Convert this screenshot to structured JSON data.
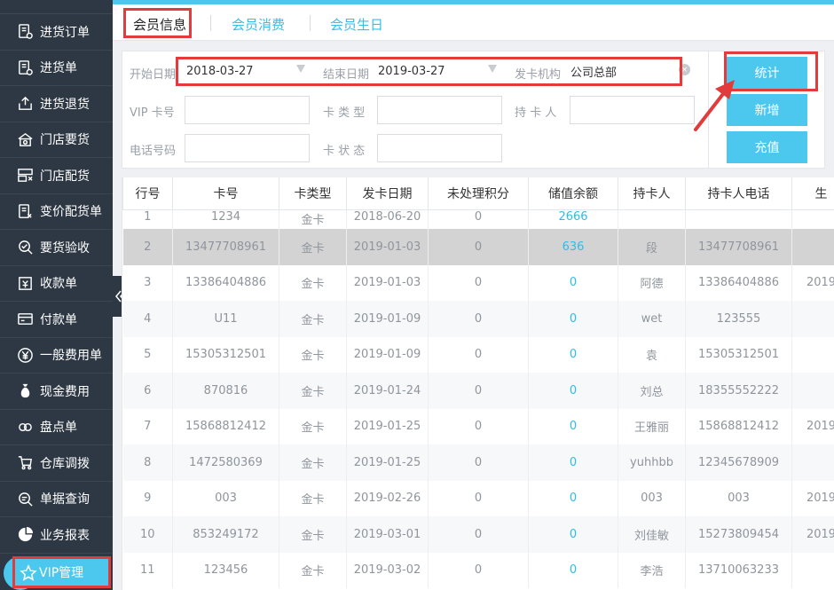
{
  "sidebar": {
    "items": [
      {
        "label": "进货订单",
        "icon": "purchase-order-icon"
      },
      {
        "label": "进货单",
        "icon": "purchase-receipt-icon"
      },
      {
        "label": "进货退货",
        "icon": "purchase-return-icon"
      },
      {
        "label": "门店要货",
        "icon": "store-request-icon"
      },
      {
        "label": "门店配货",
        "icon": "store-distribution-icon"
      },
      {
        "label": "变价配货单",
        "icon": "price-change-icon"
      },
      {
        "label": "要货验收",
        "icon": "acceptance-icon"
      },
      {
        "label": "收款单",
        "icon": "receipt-icon"
      },
      {
        "label": "付款单",
        "icon": "payment-icon"
      },
      {
        "label": "一般费用单",
        "icon": "yen-icon"
      },
      {
        "label": "现金费用",
        "icon": "cash-bag-icon"
      },
      {
        "label": "盘点单",
        "icon": "inventory-icon"
      },
      {
        "label": "仓库调拨",
        "icon": "cart-icon"
      },
      {
        "label": "单据查询",
        "icon": "search-document-icon"
      },
      {
        "label": "业务报表",
        "icon": "pie-chart-icon"
      }
    ],
    "vip": {
      "label": "VIP管理",
      "icon": "star-icon"
    }
  },
  "tabs": [
    {
      "label": "会员信息",
      "active": true
    },
    {
      "label": "会员消费",
      "active": false
    },
    {
      "label": "会员生日",
      "active": false
    }
  ],
  "filters": {
    "start_date": {
      "label": "开始日期",
      "value": "2018-03-27"
    },
    "end_date": {
      "label": "结束日期",
      "value": "2019-03-27"
    },
    "issuer": {
      "label": "发卡机构",
      "value": "公司总部"
    },
    "vip_card": {
      "label": "VIP 卡号",
      "value": ""
    },
    "card_type": {
      "label": "卡 类 型",
      "value": ""
    },
    "holder": {
      "label": "持 卡 人",
      "value": ""
    },
    "phone": {
      "label": "电话号码",
      "value": ""
    },
    "card_status": {
      "label": "卡 状 态",
      "value": ""
    }
  },
  "buttons": {
    "stat": "统计",
    "add": "新增",
    "recharge": "充值"
  },
  "table": {
    "headers": [
      "行号",
      "卡号",
      "卡类型",
      "发卡日期",
      "未处理积分",
      "储值余额",
      "持卡人",
      "持卡人电话",
      "生"
    ],
    "rows": [
      [
        "1",
        "1234",
        "金卡",
        "2018-06-20",
        "0",
        "2666",
        "",
        "",
        ""
      ],
      [
        "2",
        "13477708961",
        "金卡",
        "2019-01-03",
        "0",
        "636",
        "段",
        "13477708961",
        ""
      ],
      [
        "3",
        "13386404886",
        "金卡",
        "2019-01-03",
        "0",
        "0",
        "阿德",
        "13386404886",
        "2019"
      ],
      [
        "4",
        "U11",
        "金卡",
        "2019-01-09",
        "0",
        "0",
        "wet",
        "123555",
        ""
      ],
      [
        "5",
        "15305312501",
        "金卡",
        "2019-01-09",
        "0",
        "0",
        "袁",
        "15305312501",
        ""
      ],
      [
        "6",
        "870816",
        "金卡",
        "2019-01-24",
        "0",
        "0",
        "刘总",
        "18355552222",
        ""
      ],
      [
        "7",
        "15868812412",
        "金卡",
        "2019-01-25",
        "0",
        "0",
        "王雅丽",
        "15868812412",
        "2019"
      ],
      [
        "8",
        "1472580369",
        "金卡",
        "2019-01-25",
        "0",
        "0",
        "yuhhbb",
        "12345678909",
        ""
      ],
      [
        "9",
        "003",
        "金卡",
        "2019-02-26",
        "0",
        "0",
        "003",
        "003",
        "2019"
      ],
      [
        "10",
        "853249172",
        "金卡",
        "2019-03-01",
        "0",
        "0",
        "刘佳敏",
        "15273809454",
        "2019"
      ],
      [
        "11",
        "123456",
        "金卡",
        "2019-03-02",
        "0",
        "0",
        "李浩",
        "13710063233",
        ""
      ]
    ]
  },
  "colors": {
    "accent": "#4cc8ee",
    "sidebar": "#2e3844",
    "highlight": "#e23b3b"
  }
}
